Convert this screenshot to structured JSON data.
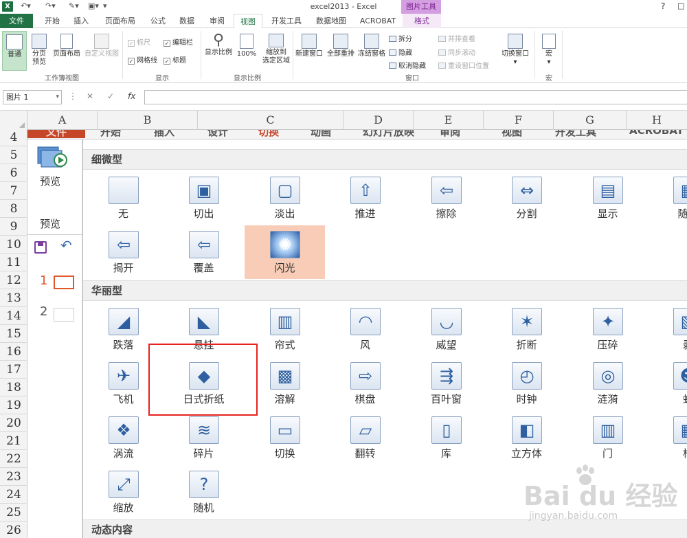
{
  "titlebar": {
    "logo": "X",
    "title": "excel2013 - Excel",
    "context_group": "图片工具",
    "help": "?",
    "restore": "□"
  },
  "ribbon_tabs": [
    {
      "label": "文件"
    },
    {
      "label": "开始"
    },
    {
      "label": "插入"
    },
    {
      "label": "页面布局"
    },
    {
      "label": "公式"
    },
    {
      "label": "数据"
    },
    {
      "label": "审阅"
    },
    {
      "label": "视图"
    },
    {
      "label": "开发工具"
    },
    {
      "label": "数据地图"
    },
    {
      "label": "ACROBAT"
    },
    {
      "label": "格式"
    }
  ],
  "ribbon": {
    "workbook_views": {
      "label": "工作簿视图",
      "normal": "普通",
      "page_break_l1": "分页",
      "page_break_l2": "预览",
      "page_layout": "页面布局",
      "custom_view": "自定义视图"
    },
    "show": {
      "label": "显示",
      "ruler": "标尺",
      "formula_bar": "编辑栏",
      "gridlines": "网格线",
      "headings": "标题"
    },
    "zoom": {
      "label": "显示比例",
      "zoom": "显示比例",
      "zoom100": "100%",
      "zoom_sel_l1": "缩放到",
      "zoom_sel_l2": "选定区域"
    },
    "window": {
      "label": "窗口",
      "new_window": "新建窗口",
      "arrange_all": "全部重排",
      "freeze": "冻结窗格",
      "split": "拆分",
      "hide": "隐藏",
      "unhide": "取消隐藏",
      "side_by_side": "并排查看",
      "sync_scroll": "同步滚动",
      "reset_pos": "重设窗口位置",
      "switch": "切换窗口"
    },
    "macros": {
      "label": "宏",
      "macro": "宏"
    }
  },
  "formula_bar": {
    "name_box": "图片 1",
    "cancel": "✕",
    "enter": "✓",
    "fx": "fx"
  },
  "columns": [
    "A",
    "B",
    "C",
    "D",
    "E",
    "F",
    "G",
    "H"
  ],
  "rows": [
    "4",
    "5",
    "6",
    "7",
    "8",
    "9",
    "10",
    "11",
    "12",
    "13",
    "14",
    "15",
    "16",
    "17",
    "18",
    "19",
    "20",
    "21",
    "22",
    "23",
    "24",
    "25",
    "26"
  ],
  "picture": {
    "pp_tabs": [
      "文件",
      "开始",
      "插入",
      "设计",
      "切换",
      "动画",
      "幻灯片放映",
      "审阅",
      "视图",
      "开发工具",
      "ACROBAT"
    ],
    "preview_label": "预览",
    "preview_group": "预览",
    "slides": [
      {
        "num": "1"
      },
      {
        "num": "2"
      }
    ],
    "sections": {
      "subtle": "细微型",
      "exciting": "华丽型",
      "dynamic": "动态内容"
    },
    "subtle_row1": [
      "无",
      "切出",
      "淡出",
      "推进",
      "擦除",
      "分割",
      "显示",
      "随机"
    ],
    "subtle_row2": [
      "揭开",
      "覆盖",
      "闪光"
    ],
    "exciting_row1": [
      "跌落",
      "悬挂",
      "帘式",
      "风",
      "威望",
      "折断",
      "压碎",
      "剥"
    ],
    "exciting_row2": [
      "飞机",
      "日式折纸",
      "溶解",
      "棋盘",
      "百叶窗",
      "时钟",
      "涟漪",
      "蜂"
    ],
    "exciting_row3": [
      "涡流",
      "碎片",
      "切换",
      "翻转",
      "库",
      "立方体",
      "门",
      "框"
    ],
    "exciting_row4": [
      "缩放",
      "随机"
    ]
  },
  "watermark": {
    "brand": "Bai du 经验",
    "url": "jingyan.baidu.com"
  }
}
